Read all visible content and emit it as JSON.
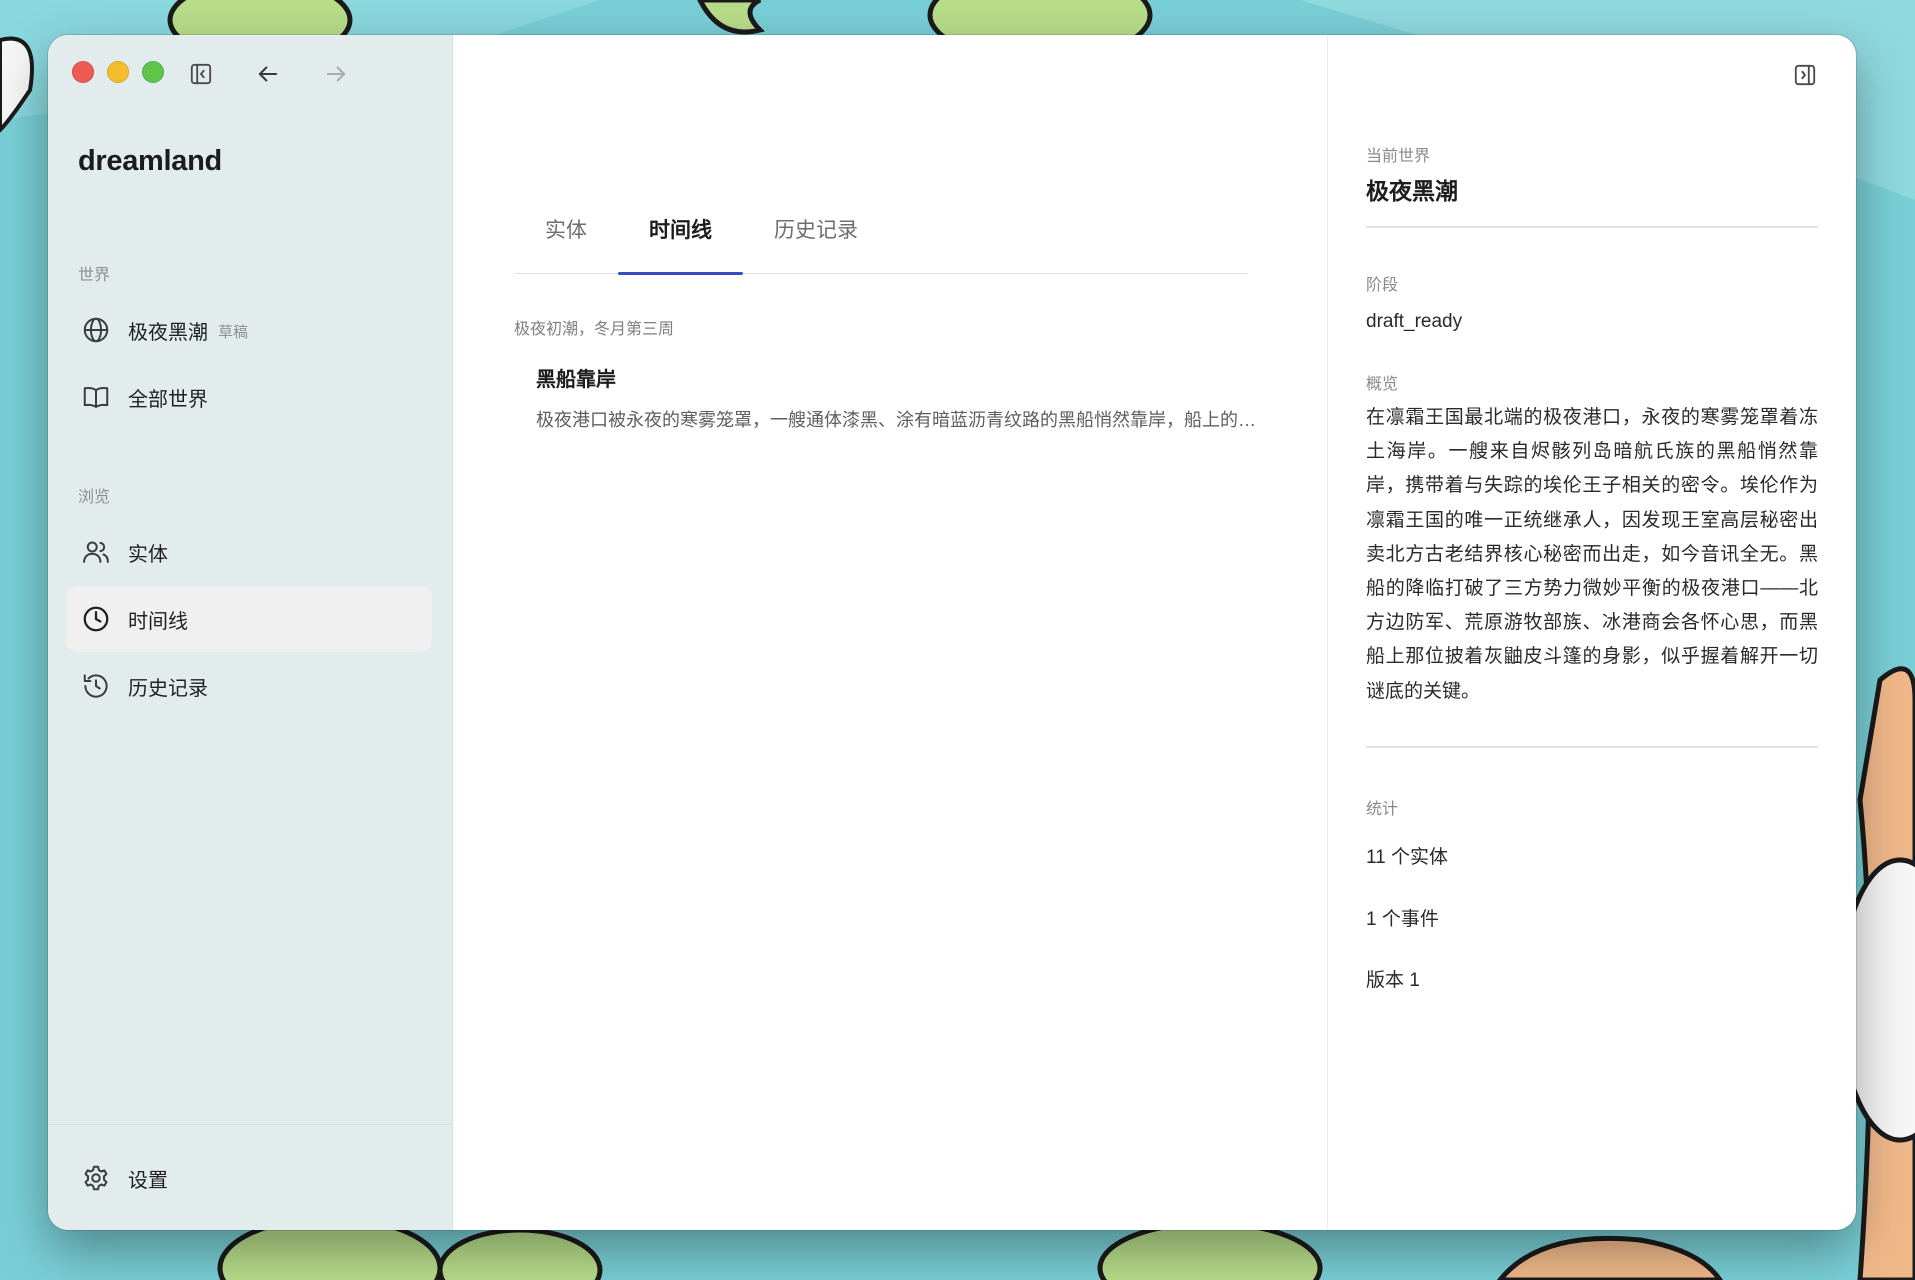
{
  "app": {
    "title": "dreamland"
  },
  "toolbar": {
    "sidebar_toggle_icon": "sidebar-left-icon",
    "back_icon": "arrow-left-icon",
    "forward_icon": "arrow-right-icon",
    "inspector_toggle_icon": "sidebar-right-icon"
  },
  "sidebar": {
    "world_section_label": "世界",
    "browse_section_label": "浏览",
    "worlds": [
      {
        "label": "极夜黑潮",
        "badge": "草稿",
        "icon": "globe-icon"
      },
      {
        "label": "全部世界",
        "icon": "book-icon"
      }
    ],
    "browse": [
      {
        "label": "实体",
        "icon": "users-icon"
      },
      {
        "label": "时间线",
        "icon": "clock-icon",
        "active": true
      },
      {
        "label": "历史记录",
        "icon": "history-icon"
      }
    ],
    "settings_label": "设置"
  },
  "main": {
    "tabs": [
      {
        "label": "实体"
      },
      {
        "label": "时间线",
        "active": true
      },
      {
        "label": "历史记录"
      }
    ],
    "events": [
      {
        "date": "极夜初潮，冬月第三周",
        "title": "黑船靠岸",
        "description": "极夜港口被永夜的寒雾笼罩，一艘通体漆黑、涂有暗蓝沥青纹路的黑船悄然靠岸，船上的人身披灰鼬皮斗篷，带来了关于失踪王子的密令。"
      }
    ]
  },
  "detail": {
    "current_world_label": "当前世界",
    "current_world": "极夜黑潮",
    "stage_label": "阶段",
    "stage": "draft_ready",
    "overview_label": "概览",
    "overview": "在凛霜王国最北端的极夜港口，永夜的寒雾笼罩着冻土海岸。一艘来自烬骸列岛暗航氏族的黑船悄然靠岸，携带着与失踪的埃伦王子相关的密令。埃伦作为凛霜王国的唯一正统继承人，因发现王室高层秘密出卖北方古老结界核心秘密而出走，如今音讯全无。黑船的降临打破了三方势力微妙平衡的极夜港口——北方边防军、荒原游牧部族、冰港商会各怀心思，而黑船上那位披着灰鼬皮斗篷的身影，似乎握着解开一切谜底的关键。",
    "stats_label": "统计",
    "stats": {
      "entities": "11 个实体",
      "events": "1 个事件",
      "version": "版本 1"
    }
  },
  "colors": {
    "accent": "#3a4bc1",
    "sidebar_bg": "#e3eced",
    "close": "#ee5b54",
    "minimize": "#f6bd2f",
    "zoom": "#5fc44c",
    "wallpaper": "#79cfd6"
  }
}
